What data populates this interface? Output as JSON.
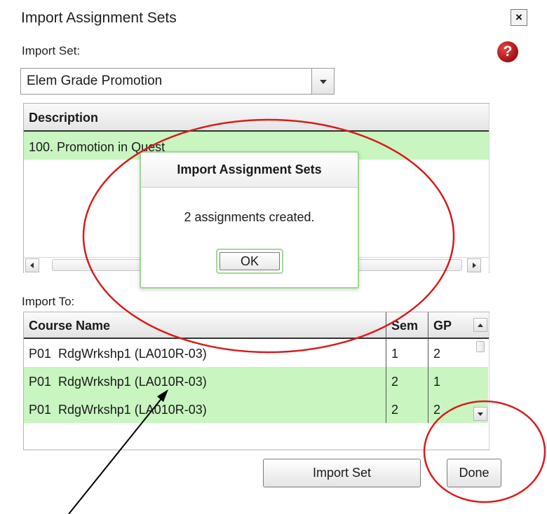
{
  "dialog": {
    "title": "Import Assignment Sets",
    "close_label": "×",
    "help_label": "?"
  },
  "import_set": {
    "label": "Import Set:",
    "selected": "Elem Grade Promotion"
  },
  "description_grid": {
    "header": "Description",
    "rows": [
      "100. Promotion in Quest"
    ]
  },
  "modal": {
    "title": "Import Assignment Sets",
    "message": "2 assignments created.",
    "ok_label": "OK"
  },
  "import_to": {
    "label": "Import To:",
    "columns": [
      "Course Name",
      "Sem",
      "GP"
    ],
    "rows": [
      {
        "course": "P01  RdgWrkshp1 (LA010R-03)",
        "sem": "1",
        "gp": "2",
        "selected": false
      },
      {
        "course": "P01  RdgWrkshp1 (LA010R-03)",
        "sem": "2",
        "gp": "1",
        "selected": true
      },
      {
        "course": "P01  RdgWrkshp1 (LA010R-03)",
        "sem": "2",
        "gp": "2",
        "selected": true
      }
    ]
  },
  "buttons": {
    "import_set": "Import Set",
    "done": "Done"
  },
  "colors": {
    "selected_row": "#c8f5c0",
    "annotation_red": "#d81b1b",
    "modal_border": "#9fd693"
  }
}
